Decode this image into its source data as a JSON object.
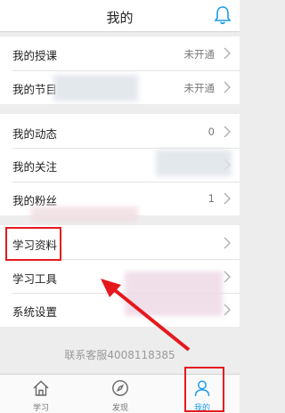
{
  "header": {
    "title": "我的",
    "bell_icon": "bell-icon"
  },
  "groups": [
    {
      "items": [
        {
          "label": "我的授课",
          "value": "未开通"
        },
        {
          "label": "我的节目",
          "value": "未开通"
        }
      ]
    },
    {
      "items": [
        {
          "label": "我的动态",
          "value": "0"
        },
        {
          "label": "我的关注",
          "value": ""
        },
        {
          "label": "我的粉丝",
          "value": "1"
        }
      ]
    },
    {
      "items": [
        {
          "label": "学习资料",
          "value": ""
        },
        {
          "label": "学习工具",
          "value": ""
        },
        {
          "label": "系统设置",
          "value": ""
        }
      ]
    }
  ],
  "footer": {
    "service_text": "联系客服4008118385"
  },
  "tabbar": [
    {
      "label": "学习",
      "icon": "home-icon",
      "active": false
    },
    {
      "label": "发现",
      "icon": "compass-icon",
      "active": false
    },
    {
      "label": "我的",
      "icon": "person-icon",
      "active": true
    }
  ],
  "colors": {
    "accent": "#1e9be9",
    "annotation_red": "#e5191d",
    "background": "#ededed"
  }
}
